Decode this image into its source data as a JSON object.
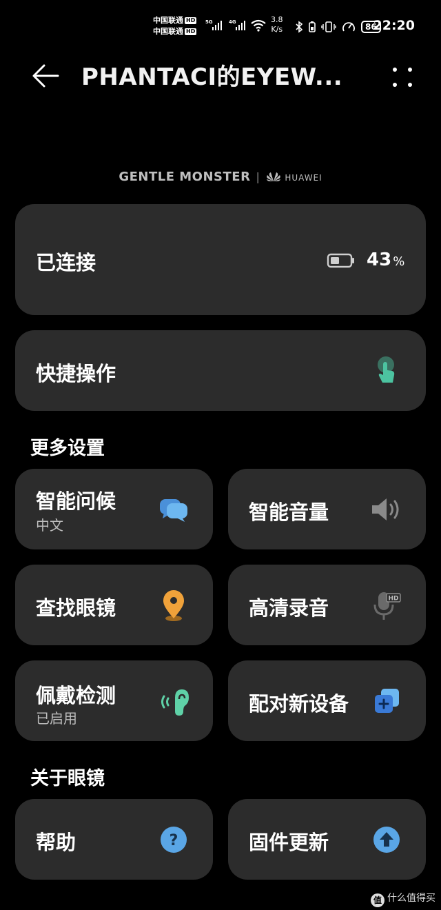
{
  "status_bar": {
    "carrier_1": "中国联通",
    "carrier_2": "中国联通",
    "hd_badge": "HD",
    "network_1": "5G",
    "network_2": "4G",
    "speed_value": "3.8",
    "speed_unit": "K/s",
    "battery_level": "86",
    "time": "22:20"
  },
  "header": {
    "title": "PHANTACI的EYEW...",
    "back_icon": "back-arrow-icon",
    "menu_icon": "more-vertical-icon"
  },
  "brand": {
    "left": "GENTLE MONSTER",
    "separator": "|",
    "right": "HUAWEI"
  },
  "connection": {
    "status": "已连接",
    "battery_percent": "43",
    "percent_sign": "%"
  },
  "quick_action": {
    "label": "快捷操作",
    "icon": "touch-gesture-icon"
  },
  "sections": {
    "more_settings": "更多设置",
    "about_glasses": "关于眼镜"
  },
  "tiles": [
    {
      "label": "智能问候",
      "sub": "中文",
      "icon": "chat-bubble-icon"
    },
    {
      "label": "智能音量",
      "sub": "",
      "icon": "speaker-volume-icon"
    },
    {
      "label": "查找眼镜",
      "sub": "",
      "icon": "location-pin-icon"
    },
    {
      "label": "高清录音",
      "sub": "",
      "icon": "hd-microphone-icon"
    },
    {
      "label": "佩戴检测",
      "sub": "已启用",
      "icon": "ear-detection-icon"
    },
    {
      "label": "配对新设备",
      "sub": "",
      "icon": "pair-device-icon"
    },
    {
      "label": "帮助",
      "sub": "",
      "icon": "help-icon"
    },
    {
      "label": "固件更新",
      "sub": "",
      "icon": "firmware-update-icon"
    }
  ],
  "watermark": {
    "badge": "值",
    "text": "什么值得买"
  },
  "colors": {
    "background": "#000000",
    "card": "#2c2c2c",
    "chat_icon": "#5aa6e6",
    "pin_icon": "#f0a23a",
    "ear_icon": "#5fd1a7",
    "touch_icon": "#4cc3a0",
    "help_icon": "#5aa6e6",
    "pair_icon": "#3a7ad6"
  }
}
